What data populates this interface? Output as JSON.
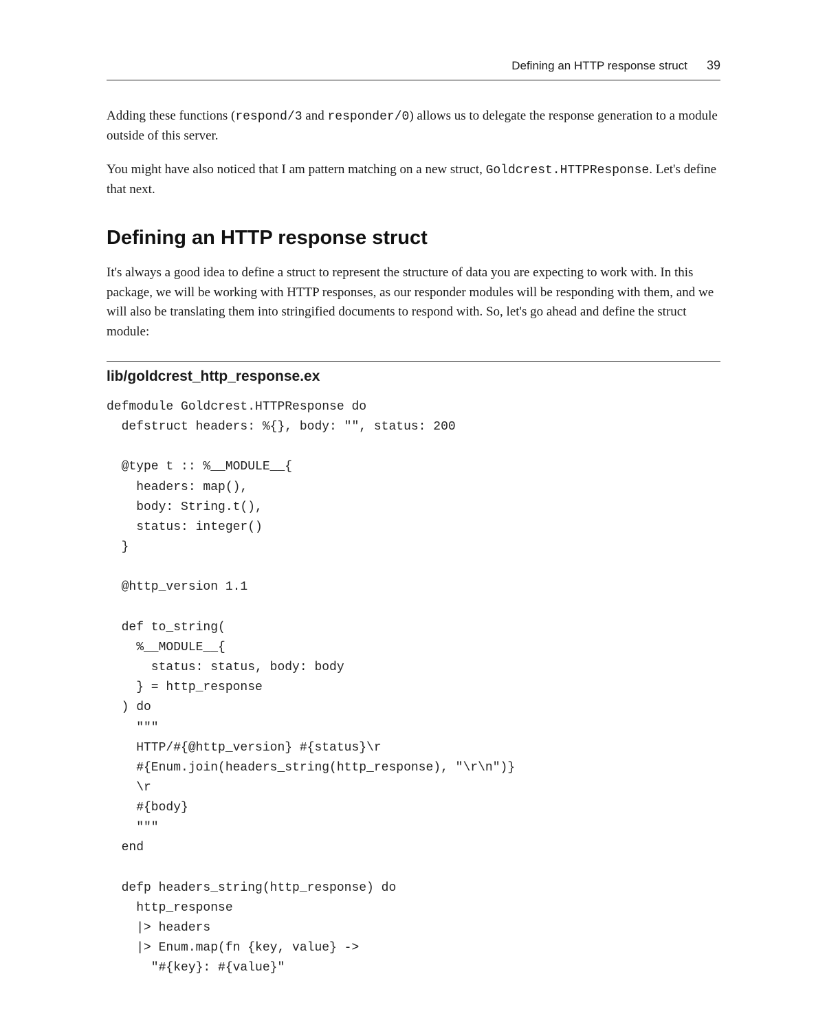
{
  "header": {
    "running_title": "Defining an HTTP response struct",
    "page_number": "39"
  },
  "paragraphs": {
    "p1_a": "Adding these functions (",
    "p1_code1": "respond/3",
    "p1_b": " and ",
    "p1_code2": "responder/0",
    "p1_c": ") allows us to delegate the response generation to a module outside of this server.",
    "p2_a": "You might have also noticed that I am pattern matching on a new struct, ",
    "p2_code1": "Goldcrest.HTTPResponse",
    "p2_b": ". Let's define that next.",
    "p3": "It's always a good idea to define a struct to represent the structure of data you are expecting to work with. In this package, we will be working with HTTP responses, as our responder modules will be responding with them, and we will also be translating them into stringified documents to respond with. So, let's go ahead and define the struct module:"
  },
  "section_heading": "Defining an HTTP response struct",
  "code": {
    "caption": "lib/goldcrest_http_response.ex",
    "body": "defmodule Goldcrest.HTTPResponse do\n  defstruct headers: %{}, body: \"\", status: 200\n\n  @type t :: %__MODULE__{\n    headers: map(),\n    body: String.t(),\n    status: integer()\n  }\n\n  @http_version 1.1\n\n  def to_string(\n    %__MODULE__{\n      status: status, body: body\n    } = http_response\n  ) do\n    \"\"\"\n    HTTP/#{@http_version} #{status}\\r\n    #{Enum.join(headers_string(http_response), \"\\r\\n\")}\n    \\r\n    #{body}\n    \"\"\"\n  end\n\n  defp headers_string(http_response) do\n    http_response\n    |> headers\n    |> Enum.map(fn {key, value} ->\n      \"#{key}: #{value}\""
  }
}
